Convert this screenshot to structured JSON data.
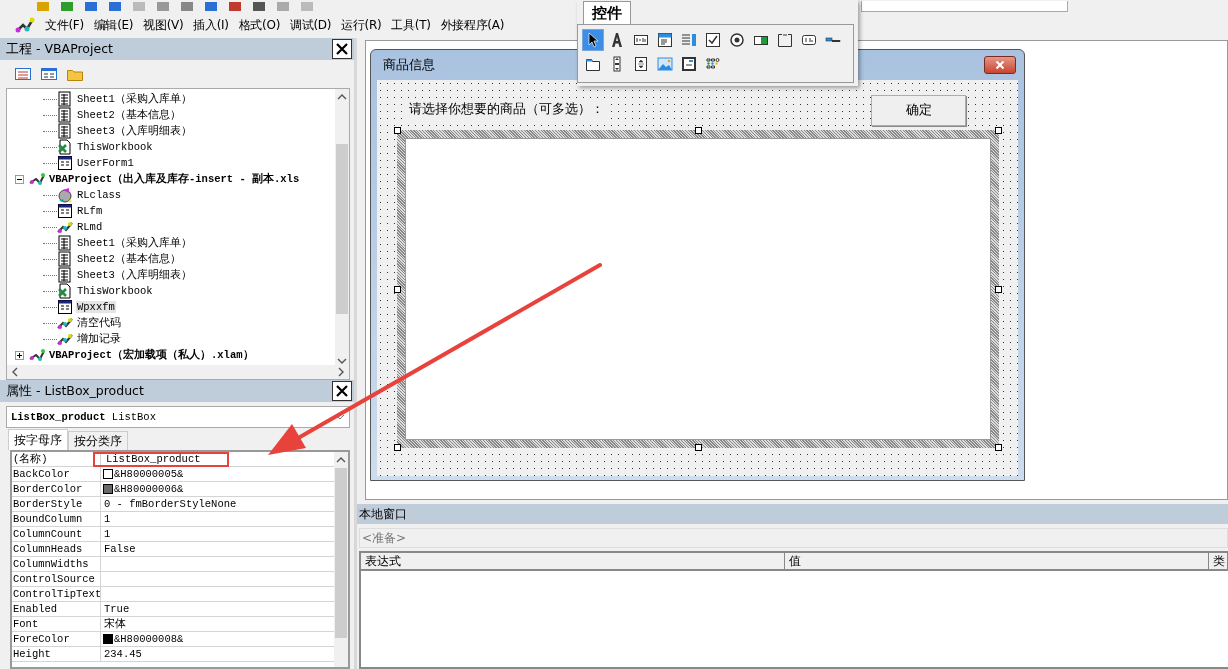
{
  "menu": [
    {
      "label": "文件(F)"
    },
    {
      "label": "编辑(E)"
    },
    {
      "label": "视图(V)"
    },
    {
      "label": "插入(I)"
    },
    {
      "label": "格式(O)"
    },
    {
      "label": "调试(D)"
    },
    {
      "label": "运行(R)"
    },
    {
      "label": "工具(T)"
    },
    {
      "label": "外接程序(A)"
    }
  ],
  "project_panel": {
    "title": "工程 - VBAProject",
    "tree": [
      {
        "children": [
          {
            "kind": "sheet",
            "label": "Sheet1（采购入库单）",
            "selected": false
          },
          {
            "kind": "sheet",
            "label": "Sheet2（基本信息）",
            "selected": false
          },
          {
            "kind": "sheet",
            "label": "Sheet3（入库明细表）",
            "selected": false
          },
          {
            "kind": "workbook",
            "label": "ThisWorkbook",
            "selected": false
          },
          {
            "kind": "form",
            "label": "UserForm1",
            "selected": false
          }
        ]
      },
      {
        "kind": "project",
        "label": "VBAProject（出入库及库存-insert - 副本.xls",
        "selected": false,
        "expanded": true,
        "children": [
          {
            "kind": "class",
            "label": "RLclass",
            "selected": false
          },
          {
            "kind": "form",
            "label": "RLfm",
            "selected": false
          },
          {
            "kind": "module",
            "label": "RLmd",
            "selected": false
          },
          {
            "kind": "sheet",
            "label": "Sheet1（采购入库单）",
            "selected": false
          },
          {
            "kind": "sheet",
            "label": "Sheet2（基本信息）",
            "selected": false
          },
          {
            "kind": "sheet",
            "label": "Sheet3（入库明细表）",
            "selected": false
          },
          {
            "kind": "workbook",
            "label": "ThisWorkbook",
            "selected": false
          },
          {
            "kind": "form",
            "label": "Wpxxfm",
            "selected": true
          },
          {
            "kind": "module",
            "label": "清空代码",
            "selected": false
          },
          {
            "kind": "module",
            "label": "增加记录",
            "selected": false
          }
        ]
      },
      {
        "kind": "project",
        "label": "VBAProject（宏加载项（私人）.xlam）",
        "selected": false,
        "expanded": false
      }
    ]
  },
  "properties_panel": {
    "title": "属性 - ListBox_product",
    "object_name": "ListBox_product",
    "object_type": "ListBox",
    "tabs": [
      {
        "label": "按字母序",
        "selected": true
      },
      {
        "label": "按分类序",
        "selected": false
      }
    ],
    "rows": [
      {
        "name": "(名称)",
        "value": "ListBox_product",
        "highlighted": true
      },
      {
        "name": "BackColor",
        "value": "&H80000005&",
        "color": "#ffffff",
        "highlighted": false
      },
      {
        "name": "BorderColor",
        "value": "&H80000006&",
        "color": "#696969",
        "highlighted": false
      },
      {
        "name": "BorderStyle",
        "value": "0 - fmBorderStyleNone",
        "highlighted": false
      },
      {
        "name": "BoundColumn",
        "value": "1",
        "highlighted": false
      },
      {
        "name": "ColumnCount",
        "value": "1",
        "highlighted": false
      },
      {
        "name": "ColumnHeads",
        "value": "False",
        "highlighted": false
      },
      {
        "name": "ColumnWidths",
        "highlighted": false
      },
      {
        "name": "ControlSource",
        "highlighted": false
      },
      {
        "name": "ControlTipText",
        "highlighted": false
      },
      {
        "name": "Enabled",
        "value": "True",
        "highlighted": false
      },
      {
        "name": "Font",
        "value": "宋体",
        "highlighted": false
      },
      {
        "name": "ForeColor",
        "value": "&H80000008&",
        "color": "#000000",
        "highlighted": false
      },
      {
        "name": "Height",
        "value": "234.45",
        "highlighted": false
      }
    ]
  },
  "user_form": {
    "title": "商品信息",
    "label": "请选择你想要的商品（可多选）：",
    "button": "确定",
    "listbox_selected": true
  },
  "toolbox": {
    "title": "控件",
    "tools": [
      {
        "kind": "pointer",
        "selected": true
      },
      {
        "kind": "label",
        "selected": false
      },
      {
        "kind": "textbox",
        "selected": false
      },
      {
        "kind": "combobox",
        "selected": false
      },
      {
        "kind": "listbox",
        "selected": false
      },
      {
        "kind": "checkbox",
        "selected": false
      },
      {
        "kind": "option",
        "selected": false
      },
      {
        "kind": "toggle",
        "selected": false
      },
      {
        "kind": "frame",
        "selected": false
      },
      {
        "kind": "command",
        "selected": false
      },
      {
        "kind": "tabstrip",
        "selected": false
      },
      {
        "kind": "multipage",
        "selected": false
      },
      {
        "kind": "scrollbar",
        "selected": false
      },
      {
        "kind": "spin",
        "selected": false
      },
      {
        "kind": "image",
        "selected": false
      },
      {
        "kind": "refedit",
        "selected": false
      },
      {
        "kind": "more",
        "selected": false
      }
    ]
  },
  "locals": {
    "title": "本地窗口",
    "status": "<准备>",
    "columns": [
      "表达式",
      "值",
      "类"
    ]
  }
}
